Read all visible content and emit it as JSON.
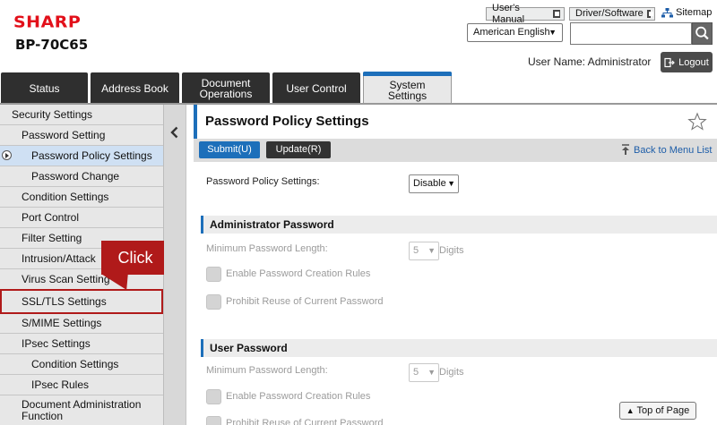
{
  "header": {
    "brand": "SHARP",
    "model": "BP-70C65",
    "users_manual": "User's Manual",
    "driver_software": "Driver/Software",
    "sitemap": "Sitemap",
    "language": "American English",
    "user_name": "User Name: Administrator",
    "logout": "Logout"
  },
  "tabs": [
    {
      "label": "Status"
    },
    {
      "label": "Address Book"
    },
    {
      "label": "Document\nOperations"
    },
    {
      "label": "User Control"
    },
    {
      "label": "System\nSettings"
    }
  ],
  "sidebar": {
    "items": [
      {
        "label": "Security Settings"
      },
      {
        "label": "Password Setting"
      },
      {
        "label": "Password Policy Settings"
      },
      {
        "label": "Password Change"
      },
      {
        "label": "Condition Settings"
      },
      {
        "label": "Port Control"
      },
      {
        "label": "Filter Setting"
      },
      {
        "label": "Intrusion/Attack"
      },
      {
        "label": "Virus Scan Setting"
      },
      {
        "label": "SSL/TLS Settings"
      },
      {
        "label": "S/MIME Settings"
      },
      {
        "label": "IPsec Settings"
      },
      {
        "label": "Condition Settings"
      },
      {
        "label": "IPsec Rules"
      },
      {
        "label": "Document Administration\nFunction"
      }
    ]
  },
  "callout": "Click",
  "main": {
    "title": "Password Policy Settings",
    "submit": "Submit(U)",
    "update": "Update(R)",
    "back": "Back to Menu List",
    "policy_label": "Password Policy Settings:",
    "policy_value": "Disable",
    "admin": {
      "header": "Administrator Password",
      "min_label": "Minimum Password Length:",
      "min_value": "5",
      "digits": "Digits",
      "rule1": "Enable Password Creation Rules",
      "rule2": "Prohibit Reuse of Current Password"
    },
    "user": {
      "header": "User Password",
      "min_label": "Minimum Password Length:",
      "min_value": "5",
      "digits": "Digits",
      "rule1": "Enable Password Creation Rules",
      "rule2": "Prohibit Reuse of Current Password"
    },
    "top_of_page": "Top of Page"
  },
  "colors": {
    "brand_red": "#e2101a",
    "accent_blue": "#1d6fba",
    "callout_red": "#b01a1a"
  }
}
